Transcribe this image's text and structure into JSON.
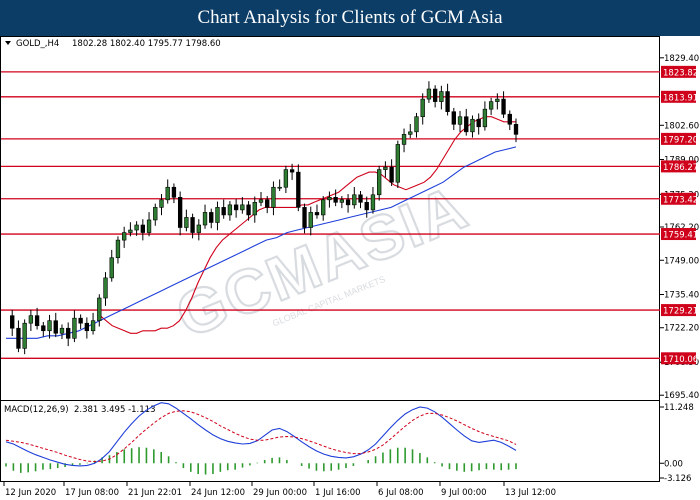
{
  "banner": {
    "title": "Chart Analysis for Clients of GCM Asia"
  },
  "colors": {
    "banner": "#0c3d66",
    "bull": "#2e7d32",
    "level_line": "#d0021b",
    "ma_fast": "#d0021b",
    "ma_slow": "#1f3fd9",
    "macd_line": "#1f3fd9",
    "signal_line": "#d0021b",
    "histogram": "#2e9a2e"
  },
  "watermark": {
    "text": "GCMASIA",
    "subtext": "GLOBAL CAPITAL MARKETS"
  },
  "chart_data": [
    {
      "type": "candlestick",
      "symbol_label": "GOLD_,H4",
      "ohlc_header": "1802.28 1802.40 1795.77 1798.60",
      "ylim": [
        1693.5,
        1832.5
      ],
      "y_ticks": [
        "1829.40",
        "1802.60",
        "1789.00",
        "1775.20",
        "1762.20",
        "1749.00",
        "1735.40",
        "1722.20",
        "1708.50",
        "1695.40"
      ],
      "x_ticks": [
        "12 Jun 2020",
        "17 Jun 08:00",
        "21 Jun 22:01",
        "24 Jun 12:00",
        "29 Jun 00:00",
        "1 Jul 16:00",
        "6 Jul 08:00",
        "9 Jul 00:00",
        "13 Jul 12:00"
      ],
      "levels": [
        1823.82,
        1813.91,
        1797.2,
        1786.27,
        1773.42,
        1759.41,
        1729.21,
        1710.06
      ],
      "levels_labels": [
        "1823.82",
        "1813.91",
        "1797.20",
        "1786.27",
        "1773.42",
        "1759.41",
        "1729.21",
        "1710.06"
      ],
      "close_path": [
        1727,
        1722,
        1714,
        1724,
        1727,
        1723,
        1721,
        1725,
        1720,
        1722,
        1718,
        1726,
        1724,
        1721,
        1725,
        1734,
        1742,
        1750,
        1757,
        1760,
        1761,
        1763,
        1760,
        1765,
        1770,
        1773,
        1778,
        1774,
        1762,
        1766,
        1760,
        1763,
        1768,
        1764,
        1770,
        1767,
        1771,
        1769,
        1771,
        1767,
        1772,
        1773,
        1770,
        1778,
        1778,
        1785,
        1784,
        1770,
        1762,
        1768,
        1767,
        1773,
        1774,
        1772,
        1773,
        1771,
        1775,
        1772,
        1769,
        1775,
        1785,
        1786,
        1780,
        1795,
        1799,
        1800,
        1806,
        1813,
        1817,
        1812,
        1816,
        1808,
        1803,
        1806,
        1800,
        1805,
        1802,
        1809,
        1812,
        1813,
        1807,
        1803,
        1799
      ],
      "ma_fast": [
        1727,
        1725,
        1723,
        1722,
        1721,
        1720,
        1720,
        1721,
        1721,
        1721,
        1722,
        1722,
        1723,
        1725,
        1729,
        1734,
        1740,
        1745,
        1750,
        1754,
        1757,
        1759,
        1761,
        1763,
        1765,
        1767,
        1769,
        1770,
        1770,
        1770,
        1770,
        1770,
        1770,
        1771,
        1771,
        1772,
        1773,
        1774,
        1775,
        1776,
        1778,
        1780,
        1782,
        1783,
        1784,
        1784,
        1783,
        1781,
        1779,
        1778,
        1777,
        1778,
        1779,
        1780,
        1782,
        1785,
        1789,
        1793,
        1797,
        1800,
        1802,
        1804,
        1805,
        1806,
        1806,
        1805,
        1804,
        1804,
        1804
      ],
      "ma_slow": [
        1718,
        1718,
        1718,
        1718,
        1719,
        1719,
        1720,
        1721,
        1723,
        1725,
        1727,
        1729,
        1731,
        1733,
        1735,
        1737,
        1739,
        1741,
        1743,
        1745,
        1747,
        1749,
        1751,
        1753,
        1755,
        1757,
        1758,
        1760,
        1761,
        1762,
        1763,
        1764,
        1765,
        1766,
        1767,
        1768,
        1769,
        1770,
        1772,
        1774,
        1776,
        1778,
        1780,
        1783,
        1786,
        1788,
        1790,
        1792,
        1793,
        1794
      ]
    },
    {
      "type": "macd",
      "label": "MACD(12,26,9)",
      "values_header": "2.381 3.495 -1.113",
      "ylim": [
        -3.126,
        11.248
      ],
      "y_ticks": [
        "11.248",
        "0.00",
        "-3.126"
      ],
      "macd": [
        4,
        3.6,
        2.9,
        2.2,
        1.6,
        1.1,
        0.6,
        0.2,
        -0.2,
        -0.4,
        -0.5,
        -0.4,
        0,
        0.9,
        2.2,
        4,
        5.8,
        7.4,
        8.8,
        9.9,
        10.7,
        11.3,
        11.1,
        10.3,
        9.3,
        8.3,
        7.2,
        6.2,
        5.3,
        4.6,
        4.1,
        3.8,
        3.6,
        3.7,
        4.2,
        5.2,
        6.2,
        6.5,
        5.9,
        5,
        4,
        3.1,
        2.3,
        1.7,
        1.3,
        1.1,
        1,
        1.2,
        1.7,
        2.5,
        3.6,
        5.1,
        6.6,
        8,
        9.2,
        10,
        10.5,
        10.3,
        9.6,
        8.6,
        7.4,
        6.2,
        5.1,
        4.2,
        3.9,
        4.1,
        4.3,
        3.9,
        3.2,
        2.4
      ],
      "signal": [
        4.3,
        4.1,
        3.9,
        3.6,
        3.2,
        2.8,
        2.4,
        2,
        1.5,
        1.1,
        0.7,
        0.4,
        0.3,
        0.4,
        0.8,
        1.6,
        2.7,
        3.9,
        5.2,
        6.4,
        7.5,
        8.5,
        9.3,
        9.7,
        9.8,
        9.6,
        9.1,
        8.5,
        7.8,
        7,
        6.3,
        5.6,
        5,
        4.5,
        4.3,
        4.3,
        4.6,
        4.9,
        5,
        4.9,
        4.6,
        4.2,
        3.7,
        3.2,
        2.7,
        2.3,
        2,
        1.8,
        1.8,
        2.1,
        2.6,
        3.4,
        4.5,
        5.7,
        6.9,
        8,
        8.8,
        9.3,
        9.3,
        9,
        8.5,
        7.9,
        7.2,
        6.5,
        5.9,
        5.4,
        5,
        4.6,
        4.2,
        3.5
      ],
      "histogram": [
        -0.6,
        -1.4,
        -1.8,
        -1.7,
        -1.5,
        -1.2,
        -1.1,
        -0.9,
        -0.7,
        -0.5,
        -0.3,
        0.1,
        0.5,
        1.1,
        1.5,
        2.1,
        2.6,
        2.8,
        3,
        2.9,
        2.6,
        2.1,
        1.3,
        0.2,
        -0.9,
        -1.6,
        -2,
        -2.1,
        -2,
        -1.6,
        -1.3,
        -1.2,
        -0.8,
        -0.4,
        0.1,
        0.6,
        1,
        1.1,
        0.6,
        0,
        -0.5,
        -1,
        -1.4,
        -1.5,
        -1.4,
        -1.2,
        -0.9,
        -0.5,
        0,
        0.6,
        1.3,
        2,
        2.6,
        2.9,
        2.9,
        2.6,
        1.9,
        1.1,
        0.2,
        -0.6,
        -1.1,
        -1.4,
        -1.6,
        -1.5,
        -1.3,
        -1.1,
        -1.2,
        -1.3,
        -1.2,
        -1.1
      ]
    }
  ]
}
